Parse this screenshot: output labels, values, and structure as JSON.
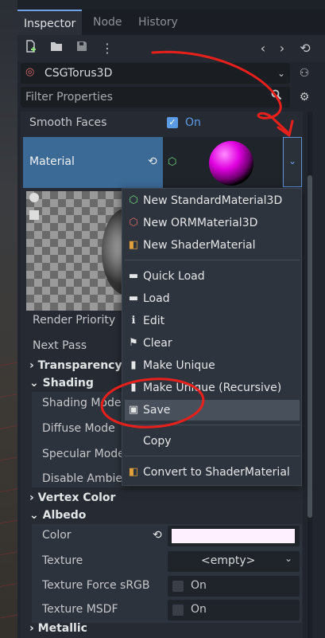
{
  "tabs": [
    "Inspector",
    "Node",
    "History"
  ],
  "toolbar": {
    "icons": [
      "new-resource-icon",
      "open-folder-icon",
      "save-icon",
      "more-vertical-icon",
      "back-arrow-icon",
      "forward-arrow-icon",
      "history-icon"
    ]
  },
  "object_selector": {
    "value": "CSGTorus3D"
  },
  "filter": {
    "placeholder": "Filter Properties"
  },
  "properties": {
    "smooth_faces": {
      "label": "Smooth Faces",
      "value": "On",
      "checked": true
    },
    "material": {
      "label": "Material"
    },
    "render_priority": "Render Priority",
    "next_pass": "Next Pass",
    "transparency": "Transparency",
    "shading": "Shading",
    "shading_mode": "Shading Mode",
    "diffuse_mode": "Diffuse Mode",
    "specular_mode": "Specular Mode",
    "disable_ambient": "Disable Ambier",
    "vertex_color": "Vertex Color",
    "albedo": "Albedo",
    "color": "Color",
    "texture": {
      "label": "Texture",
      "value": "<empty>"
    },
    "texture_force_srgb": {
      "label": "Texture Force sRGB",
      "value": "On",
      "checked": false
    },
    "texture_msdf": {
      "label": "Texture MSDF",
      "value": "On",
      "checked": false
    },
    "metallic": "Metallic"
  },
  "menu": {
    "items": [
      {
        "label": "New StandardMaterial3D",
        "icon": "standard-material-icon"
      },
      {
        "label": "New ORMMaterial3D",
        "icon": "orm-material-icon"
      },
      {
        "label": "New ShaderMaterial",
        "icon": "shader-material-icon"
      },
      {
        "label": "Quick Load",
        "icon": "folder-icon"
      },
      {
        "label": "Load",
        "icon": "folder-icon"
      },
      {
        "label": "Edit",
        "icon": "edit-icon"
      },
      {
        "label": "Clear",
        "icon": "clear-icon"
      },
      {
        "label": "Make Unique",
        "icon": "file-icon"
      },
      {
        "label": "Make Unique (Recursive)",
        "icon": "file-icon"
      },
      {
        "label": "Save",
        "icon": "save-icon"
      },
      {
        "label": "Copy",
        "icon": ""
      },
      {
        "label": "Convert to ShaderMaterial",
        "icon": "shader-material-icon"
      }
    ]
  },
  "colors": {
    "accent": "#5b9be6",
    "material_row": "#3b6a96",
    "annotation": "#e8201c",
    "albedo_color": "#fff0ff"
  }
}
